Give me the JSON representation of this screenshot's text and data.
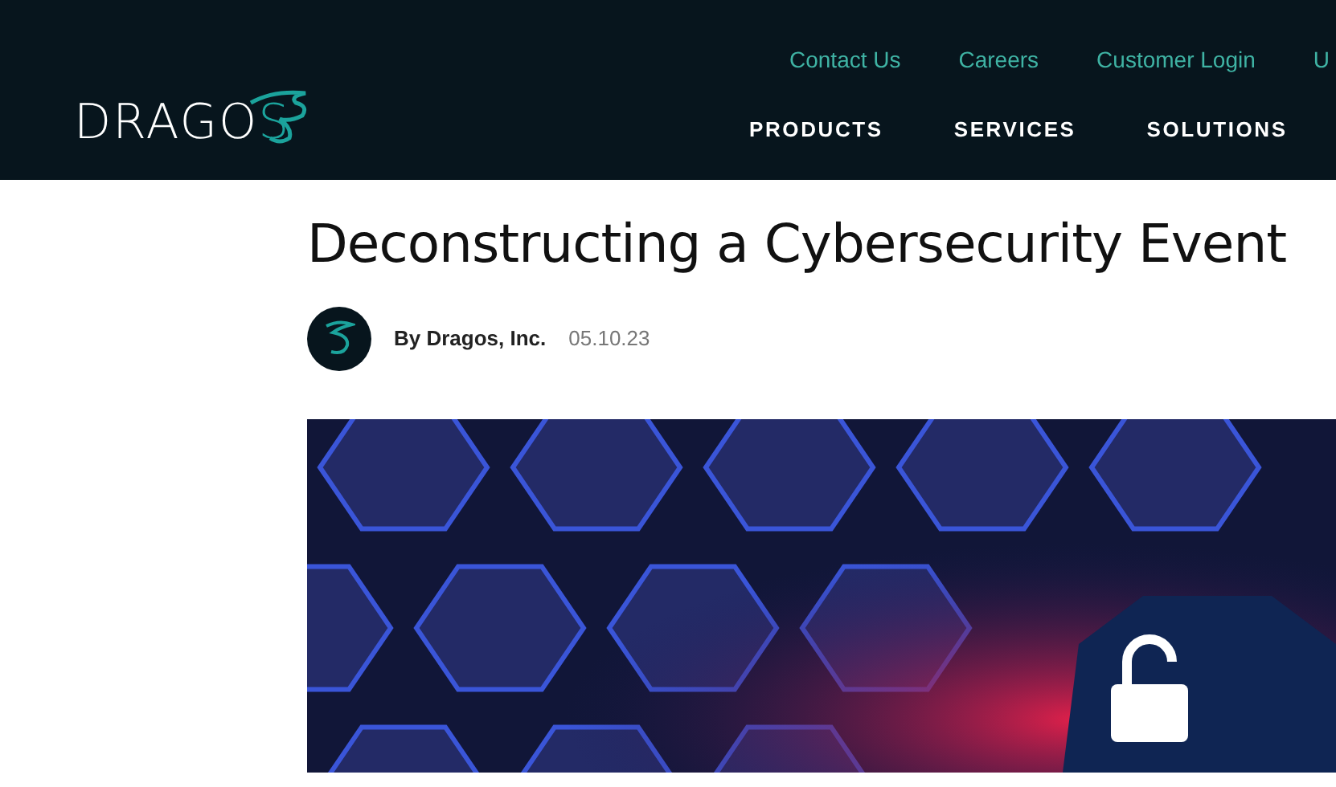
{
  "header": {
    "logo": {
      "text": "DRAGO",
      "accent": "S"
    },
    "utility_links": [
      "Contact Us",
      "Careers",
      "Customer Login",
      "U"
    ],
    "main_nav": [
      "PRODUCTS",
      "SERVICES",
      "SOLUTIONS"
    ]
  },
  "article": {
    "title": "Deconstructing a Cybersecurity Event",
    "author": "By Dragos, Inc.",
    "date": "05.10.23"
  }
}
